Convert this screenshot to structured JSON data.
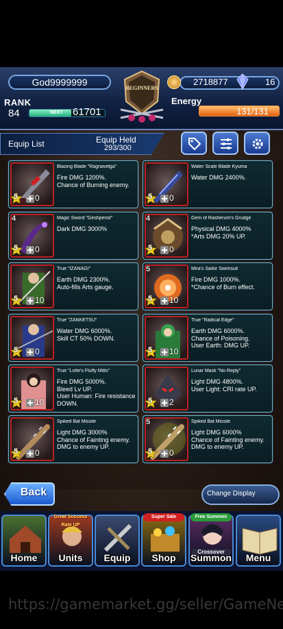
{
  "header": {
    "player_name": "God9999999",
    "emblem_text": "BEGINNERS",
    "rank_label": "RANK",
    "rank": "84",
    "next_label": "NEXT",
    "next_xp": "61701",
    "xp_fraction": 0.55,
    "gold": "2718877",
    "gems": "16",
    "energy_label": "Energy",
    "energy": "131/131",
    "energy_fraction": 1.0
  },
  "toolbar": {
    "title": "Equip List",
    "held_label": "Equip Held",
    "held_value": "293/300",
    "buttons": [
      "tag-icon",
      "sort-icon",
      "gear-icon"
    ]
  },
  "equipment": [
    {
      "name": "Blazing Blade \"Ragnavelga\"",
      "desc": "Fire DMG 1200%.\nChance of Burning enemy.",
      "rarity": "5",
      "plus": "0",
      "grade": "",
      "art": "red-blade"
    },
    {
      "name": "Water Scale Blade Kyuma",
      "desc": "Water DMG 2400%.",
      "rarity": "5",
      "plus": "0",
      "grade": "",
      "art": "blue-blade"
    },
    {
      "name": "Magic Sword \"Geshpenst\"",
      "desc": "Dark DMG 3000%",
      "rarity": "5",
      "plus": "0",
      "grade": "4",
      "art": "purple-blade"
    },
    {
      "name": "Gem of Rasherum's Grudge",
      "desc": "Physical DMG 4000%\n*Arts DMG 20% UP.",
      "rarity": "5",
      "plus": "0",
      "grade": "4",
      "art": "gem-mask"
    },
    {
      "name": "True \"IZANAGI\"",
      "desc": "Earth DMG 2300%.\nAuto-fills Arts gauge.",
      "rarity": "5",
      "plus": "10",
      "grade": "",
      "art": "green-hero"
    },
    {
      "name": "Mira's Sailor Swimsuit",
      "desc": "Fire DMG 1000%.\n*Chance of Burn effect.",
      "rarity": "5",
      "plus": "10",
      "grade": "5",
      "art": "orange-orb"
    },
    {
      "name": "True \"ZANKETSU\"",
      "desc": "Water DMG 6000%.\nSkill CT 50% DOWN.",
      "rarity": "5",
      "plus": "0",
      "grade": "",
      "art": "blue-hero"
    },
    {
      "name": "True \"Radical Edge\"",
      "desc": "Earth DMG 6000%.\nChance of Poisoning.\nUser Earth: DMG UP.",
      "rarity": "5",
      "plus": "10",
      "grade": "",
      "art": "green-girl"
    },
    {
      "name": "True \"Lotte's Fluffy Mitts\"",
      "desc": "Fire DMG 5000%.\nBleed Lv UP.\nUser Human: Fire resistance DOWN.",
      "rarity": "5",
      "plus": "10",
      "grade": "",
      "art": "pink-girl"
    },
    {
      "name": "Lunar Mask \"No Reply\"",
      "desc": "Light DMG 4800%.\nUser Light: CRI rate UP.",
      "rarity": "5",
      "plus": "2",
      "grade": "",
      "art": "dark-mask"
    },
    {
      "name": "Spiked Bat Missile",
      "desc": "Light DMG 3000%\nChance of Fainting enemy.\nDMG to enemy UP.",
      "rarity": "5",
      "plus": "0",
      "grade": "",
      "art": "bat"
    },
    {
      "name": "Spiked Bat Missile",
      "desc": "Light DMG 6000%\nChance of Fainting enemy.\nDMG to enemy UP.",
      "rarity": "5",
      "plus": "0",
      "grade": "5",
      "art": "bat-glow"
    }
  ],
  "back_label": "Back",
  "change_display_label": "Change Display",
  "nav": [
    {
      "label": "Home",
      "badge": "",
      "color": "#4a7030"
    },
    {
      "label": "Units",
      "badge": "Great Success Rate UP",
      "color": "#9a3a20"
    },
    {
      "label": "Equip",
      "badge": "",
      "color": "#3a4a70"
    },
    {
      "label": "Shop",
      "badge": "Super Sale",
      "color": "#8a6a10"
    },
    {
      "label": "Summon",
      "badge": "Free Summon",
      "color": "#5a2a60"
    },
    {
      "label": "Menu",
      "badge": "",
      "color": "#2a4a80"
    }
  ],
  "nav_sub": {
    "summon_banner": "Crossover"
  },
  "watermark": "https://gamemarket.gg/seller/GameNe"
}
